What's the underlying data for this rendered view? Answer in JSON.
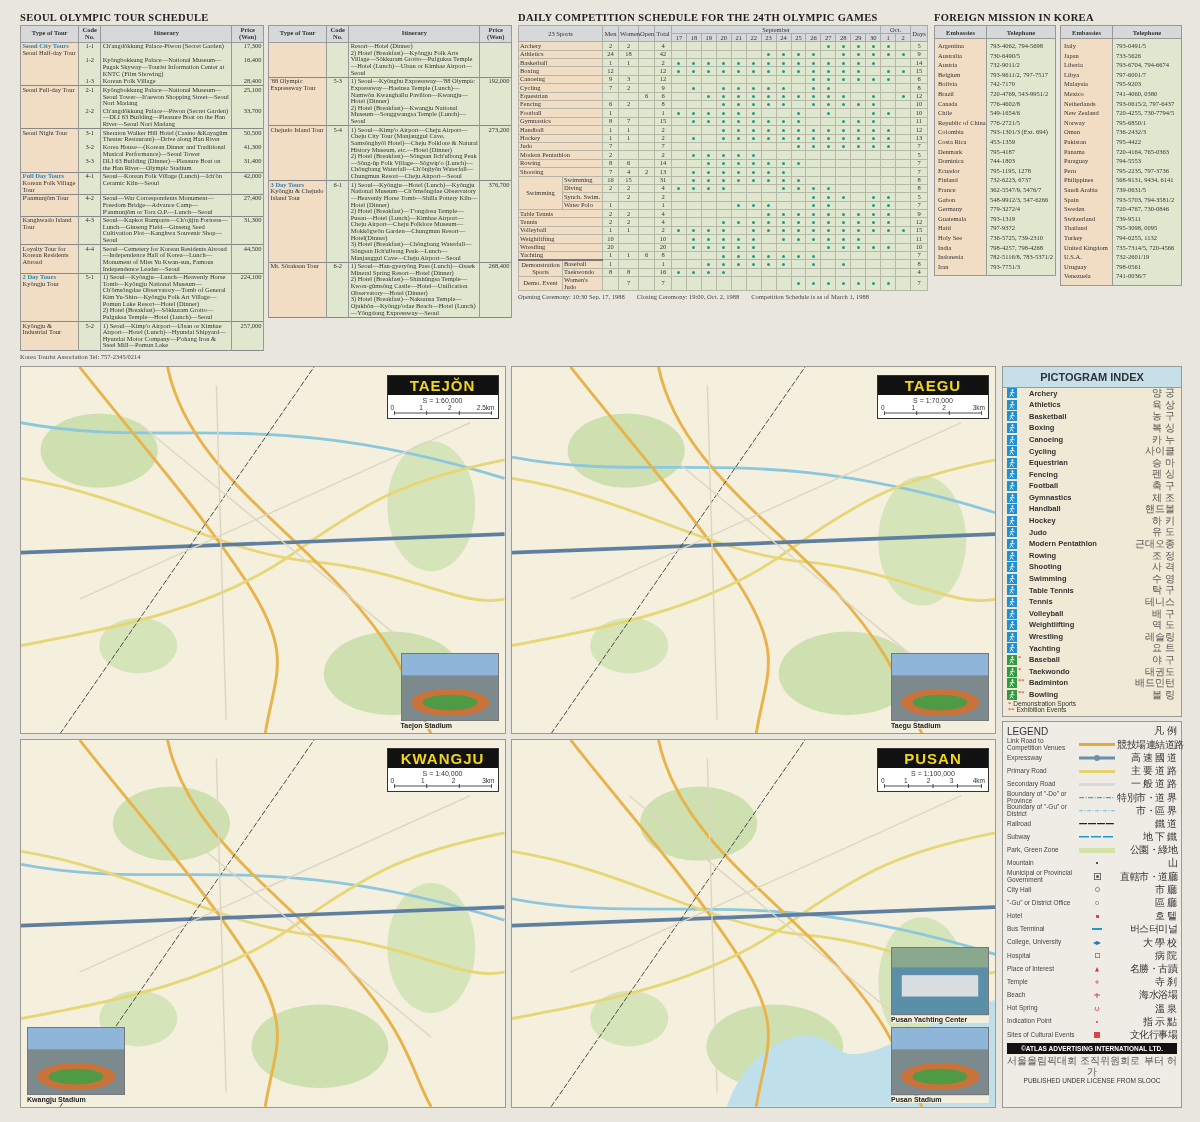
{
  "tour_schedule": {
    "title": "SEOUL OLYMPIC TOUR SCHEDULE",
    "tables": [
      {
        "columns": [
          "Type of Tour",
          "Code No.",
          "Itinerary",
          "Price (Won)"
        ],
        "rows": [
          {
            "group": "Seoul City Tours",
            "type": "Seoul Half-day Tour",
            "code": "1-1",
            "itinerary": [
              "Ch'angdŏkkung Palace-Piwon (Secret Garden)"
            ],
            "price": "17,300"
          },
          {
            "code": "1-2",
            "itinerary": [
              "Kyŏngbokkung Palace—National Museum—Pugak Skyway—Tourist Information Center at KNTC (Film Showing)"
            ],
            "price": "16,400"
          },
          {
            "code": "1-3",
            "itinerary": [
              "Korean Folk Village"
            ],
            "price": "28,400"
          },
          {
            "type": "Seoul Full-day Tour",
            "code": "2-1",
            "itinerary": [
              "Kyŏngbokkung Palace—National Museum—Seoul Tower—It'aewon Shopping Street—Seoul Nori Madang"
            ],
            "price": "25,100"
          },
          {
            "code": "2-2",
            "itinerary": [
              "Ch'angdŏkkung Palace—Piwon (Secret Garden)—DLI 63 Building—Pleasure Boat on the Han River—Seoul Nori Madang"
            ],
            "price": "33,700"
          },
          {
            "type": "Seoul Night Tour",
            "code": "3-1",
            "itinerary": [
              "Sheraton Walker Hill Hotel (Casino &Kayagŭm Theater Restaurant)—Drive along Han River"
            ],
            "price": "50,500"
          },
          {
            "code": "3-2",
            "itinerary": [
              "Korea House—(Korean Dinner and Traditional Musical Performance)—Seoul Tower"
            ],
            "price": "41,300"
          },
          {
            "code": "3-3",
            "itinerary": [
              "DLI 63 Building (Dinner)—Pleasure Boat on the Han River—Olympic Stadium"
            ],
            "price": "31,400"
          },
          {
            "group": "Full Day Tours",
            "type": "Korean Folk Village Tour",
            "code": "4-1",
            "itinerary": [
              "Seoul—Korean Folk Village (Lunch)—Ich'ŏn Ceramic Kiln—Seoul"
            ],
            "price": "42,000"
          },
          {
            "type": "P'anmunjŏm Tour",
            "code": "4-2",
            "itinerary": [
              "Seoul—War Correspondents Monument—Freedom Bridge—Advance Camp—P'anmunjŏm or Tora O.P.—Lunch—Seoul"
            ],
            "price": "27,400"
          },
          {
            "type": "Kanghwado Island Tour",
            "code": "4-3",
            "itinerary": [
              "Seoul—Kapkot Ramparts—Ch'ojijin Fortress—Lunch—Ginseng Field—Ginseng Seed Cultivation Plot—Kanghwa Souvenir Shop—Seoul"
            ],
            "price": "31,300"
          },
          {
            "type": "Loyalty Tour for Korean Residents Abroad",
            "code": "4-4",
            "itinerary": [
              "Seoul—Cemetery for Korean Residents Abroad—Independence Hall of Korea—Lunch—Monument of Miss Yu Kwan-sun, Famous Independence Leader—Seoul"
            ],
            "price": "44,500"
          },
          {
            "group": "2 Day Tours",
            "type": "Kyŏngju Tour",
            "code": "5-1",
            "itinerary": [
              "1) Seoul—Kyŏngju—Lunch—Heavenly Horse Tomb—Kyŏngju National Museum—Ch'ŏmsŏngdae Observatory—Tomb of General Kim Yu-Shin—Kyŏngju Folk Art Village—Pomun Lake Resort—Hotel (Dinner)",
              "2) Hotel (Breakfast)—Sŏkkuram Grotto—Pulguksa Temple—Hotel (Lunch)—Seoul"
            ],
            "price": "224,100"
          },
          {
            "type": "Kyŏngju & Industrial Tour",
            "code": "5-2",
            "itinerary": [
              "1) Seoul—Kimp'o Airport—Ulsan or Kimhae Airport—Hotel (Lunch)—Hyundai Shipyard—Hyundai Motor Company—P'ohang Iron & Steel Mill—Pomun Lake"
            ],
            "price": "257,000"
          }
        ]
      },
      {
        "columns": [
          "Type of Tour",
          "Code No.",
          "Itinerary",
          "Price (Won)"
        ],
        "rows": [
          {
            "itinerary": [
              "Resort—Hotel (Dinner)",
              "2) Hotel (Breakfast)—Kyŏngju Folk Arts Village—Sŏkkuram Grotto—Pulguksa Temple—Hotel (Lunch)—Ulsan or Kimhae Airport—Seoul"
            ]
          },
          {
            "type": "'88 Olympic Expressway Tour",
            "code": "5-3",
            "itinerary": [
              "1) Seoul—Kyŏngbu Expressway—'88 Olympic Expressway—Haeinsa Temple (Lunch)—Namwŏn Kwanghallu Pavilion—Kwangju—Hotel (Dinner)",
              "2) Hotel (Breakfast)—Kwangju National Museum—Songgwangsa Temple (Lunch)—Seoul"
            ],
            "price": "192,000"
          },
          {
            "type": "Chejudo Island Tour",
            "code": "5-4",
            "itinerary": [
              "1) Seoul—Kimp'o Airport—Cheju Airport—Cheju City Tour (Manjanggul Cave, Samsŏnghyŏl Hotel)—Cheju Folklore & Natural History Museum, etc.—Hotel (Dinner)",
              "2) Hotel (Breakfast)—Sŏngsan Ilch'ulbong Peak—Sŏng-ŭp Folk Village—Sŏgwip'o (Lunch)—Chŏngbang Waterfall—Ch'ŏnjiyŏn Waterfall—Chungmun Resort—Cheju Airport—Seoul"
            ],
            "price": "273,200"
          },
          {
            "group": "3 Day Tours",
            "type": "Kyŏngju & Chejudo Island Tour",
            "code": "6-1",
            "itinerary": [
              "1) Seoul—Kyŏngju—Hotel (Lunch)—Kyŏngju National Museum—Ch'ŏmsŏngdae Observatory—Heavenly Horse Tomb—Shilla Pottery Kiln—Hotel (Dinner)",
              "2) Hotel (Breakfast)—T'ongdosa Temple—Pusan—Hotel (Lunch)—Kimhae Airport—Cheju Airport—Cheju Folklore Museum—Mokkŏgwŏn Garden—Chungmun Resort—Hotel(Dinner)",
              "3) Hotel (Breakfast)—Chŏngbang Waterfall—Sŏngsan Ilch'ulbong Peak—Lunch—Manjanggul Cave—Cheju Airport—Seoul"
            ],
            "price": "376,700"
          },
          {
            "type": "Mt. Sŏraksan Tour",
            "code": "6-2",
            "itinerary": [
              "1) Seoul—Han-gyeryŏng Pass (Lunch)—Osaek Mineral Spring Resort—Hotel (Dinner)",
              "2) Hotel (Breakfast)—Shinhŭngsa Temple—Kwon-gŭmsŏng Castle—Hotel—Unification Observatory—Hotel (Dinner)",
              "3) Hotel (Breakfast)—Naksansa Temple—Ojukhŏn—Kyŏngp'odae Beach—Hotel (Lunch)—Yŏngdong Expressway—Seoul"
            ],
            "price": "268,400"
          }
        ]
      }
    ],
    "footer": "Korea Tourist Association   Tel: 757-2345/0214"
  },
  "competition_schedule": {
    "title": "DAILY COMPETITION SCHEDULE FOR THE 24TH OLYMPIC GAMES",
    "headers": {
      "sports": "23 Sports",
      "men": "Men",
      "women": "Women",
      "open": "Open",
      "total": "Total",
      "september": "September",
      "october": "Oct.",
      "days": "Days"
    },
    "september_days": [
      "17",
      "18",
      "19",
      "20",
      "21",
      "22",
      "23",
      "24",
      "25",
      "26",
      "27",
      "28",
      "29",
      "30"
    ],
    "october_days": [
      "1",
      "2"
    ],
    "rows": [
      {
        "sport": "Archery",
        "men": "2",
        "women": "2",
        "total": "4",
        "days": "5",
        "days_on": [
          false,
          false,
          false,
          false,
          false,
          false,
          false,
          false,
          false,
          false,
          true,
          true,
          true,
          true,
          true,
          false
        ]
      },
      {
        "sport": "Athletics",
        "men": "24",
        "women": "18",
        "total": "42",
        "days": "9",
        "days_on": [
          false,
          false,
          false,
          false,
          false,
          false,
          true,
          true,
          true,
          true,
          false,
          true,
          true,
          true,
          true,
          true
        ]
      },
      {
        "sport": "Basketball",
        "men": "1",
        "women": "1",
        "total": "2",
        "days": "14",
        "days_on": [
          true,
          true,
          true,
          true,
          true,
          true,
          true,
          true,
          true,
          true,
          true,
          true,
          true,
          true,
          false,
          false
        ]
      },
      {
        "sport": "Boxing",
        "men": "12",
        "total": "12",
        "days": "15",
        "days_on": [
          true,
          true,
          true,
          true,
          true,
          true,
          true,
          true,
          true,
          true,
          true,
          true,
          true,
          false,
          true,
          true
        ]
      },
      {
        "sport": "Canoeing",
        "men": "9",
        "women": "3",
        "total": "12",
        "days": "6",
        "days_on": [
          false,
          false,
          false,
          false,
          false,
          false,
          false,
          false,
          false,
          true,
          true,
          true,
          true,
          true,
          true,
          false
        ]
      },
      {
        "sport": "Cycling",
        "men": "7",
        "women": "2",
        "total": "9",
        "days": "8",
        "days_on": [
          false,
          true,
          false,
          true,
          true,
          true,
          true,
          true,
          false,
          true,
          true,
          false,
          false,
          false,
          false,
          false
        ]
      },
      {
        "sport": "Equestrian",
        "open": "6",
        "total": "6",
        "days": "12",
        "days_on": [
          false,
          false,
          true,
          true,
          true,
          true,
          true,
          true,
          true,
          true,
          true,
          true,
          false,
          true,
          false,
          true
        ]
      },
      {
        "sport": "Fencing",
        "men": "6",
        "women": "2",
        "total": "8",
        "days": "10",
        "days_on": [
          false,
          false,
          false,
          true,
          true,
          true,
          true,
          true,
          false,
          true,
          true,
          true,
          true,
          true,
          false,
          false
        ]
      },
      {
        "sport": "Football",
        "men": "1",
        "total": "1",
        "days": "10",
        "days_on": [
          true,
          true,
          true,
          true,
          true,
          true,
          false,
          false,
          true,
          false,
          true,
          false,
          false,
          true,
          true,
          false
        ]
      },
      {
        "sport": "Gymnastics",
        "men": "8",
        "women": "7",
        "total": "15",
        "days": "11",
        "days_on": [
          false,
          true,
          true,
          true,
          true,
          true,
          true,
          true,
          true,
          false,
          false,
          true,
          true,
          true,
          false,
          false
        ]
      },
      {
        "sport": "Handball",
        "men": "1",
        "women": "1",
        "total": "2",
        "days": "12",
        "days_on": [
          false,
          false,
          false,
          true,
          true,
          true,
          true,
          true,
          true,
          true,
          true,
          true,
          true,
          true,
          true,
          false
        ]
      },
      {
        "sport": "Hockey",
        "men": "1",
        "women": "1",
        "total": "2",
        "days": "13",
        "days_on": [
          false,
          true,
          false,
          true,
          true,
          true,
          true,
          true,
          true,
          true,
          true,
          true,
          true,
          true,
          true,
          false
        ]
      },
      {
        "sport": "Judo",
        "men": "7",
        "total": "7",
        "days": "7",
        "days_on": [
          false,
          false,
          false,
          false,
          false,
          false,
          false,
          false,
          true,
          true,
          true,
          true,
          true,
          true,
          true,
          false
        ]
      },
      {
        "sport": "Modern Pentathlon",
        "men": "2",
        "total": "2",
        "days": "5",
        "days_on": [
          false,
          true,
          true,
          true,
          true,
          true,
          false,
          false,
          false,
          false,
          false,
          false,
          false,
          false,
          false,
          false
        ]
      },
      {
        "sport": "Rowing",
        "men": "8",
        "women": "6",
        "total": "14",
        "days": "7",
        "days_on": [
          false,
          false,
          true,
          true,
          true,
          true,
          true,
          true,
          true,
          false,
          false,
          false,
          false,
          false,
          false,
          false
        ]
      },
      {
        "sport": "Shooting",
        "men": "7",
        "women": "4",
        "open": "2",
        "total": "13",
        "days": "7",
        "days_on": [
          false,
          true,
          true,
          true,
          true,
          true,
          true,
          true,
          false,
          false,
          false,
          false,
          false,
          false,
          false,
          false
        ]
      },
      {
        "sport": "Swimming",
        "events": [
          {
            "event": "Swimming",
            "men": "16",
            "women": "15",
            "total": "31",
            "days": "8",
            "days_on": [
              false,
              true,
              true,
              true,
              true,
              true,
              true,
              true,
              true,
              false,
              false,
              false,
              false,
              false,
              false,
              false
            ]
          },
          {
            "event": "Diving",
            "men": "2",
            "women": "2",
            "total": "4",
            "days": "8",
            "days_on": [
              true,
              true,
              true,
              true,
              false,
              false,
              false,
              true,
              true,
              true,
              true,
              false,
              false,
              false,
              false,
              false
            ]
          },
          {
            "event": "Synch. Swim.",
            "women": "2",
            "total": "2",
            "days": "5",
            "days_on": [
              false,
              false,
              false,
              false,
              false,
              false,
              false,
              false,
              false,
              true,
              true,
              true,
              false,
              true,
              true,
              false
            ]
          },
          {
            "event": "Water Polo",
            "men": "1",
            "total": "1",
            "days": "7",
            "days_on": [
              false,
              false,
              false,
              false,
              true,
              true,
              true,
              false,
              false,
              true,
              true,
              false,
              false,
              true,
              true,
              false
            ]
          }
        ]
      },
      {
        "sport": "Table Tennis",
        "men": "2",
        "women": "2",
        "total": "4",
        "days": "9",
        "days_on": [
          false,
          false,
          false,
          false,
          false,
          false,
          true,
          true,
          true,
          true,
          true,
          true,
          true,
          true,
          true,
          false
        ]
      },
      {
        "sport": "Tennis",
        "men": "2",
        "women": "2",
        "total": "4",
        "days": "12",
        "days_on": [
          false,
          false,
          false,
          true,
          true,
          true,
          true,
          true,
          true,
          true,
          true,
          true,
          true,
          true,
          true,
          false
        ]
      },
      {
        "sport": "Volleyball",
        "men": "1",
        "women": "1",
        "total": "2",
        "days": "15",
        "days_on": [
          true,
          true,
          true,
          true,
          false,
          true,
          true,
          true,
          true,
          true,
          true,
          true,
          true,
          true,
          true,
          true
        ]
      },
      {
        "sport": "Weightlifting",
        "men": "10",
        "total": "10",
        "days": "11",
        "days_on": [
          false,
          true,
          true,
          true,
          true,
          true,
          false,
          true,
          true,
          true,
          true,
          true,
          true,
          false,
          false,
          false
        ]
      },
      {
        "sport": "Wrestling",
        "men": "20",
        "total": "20",
        "days": "10",
        "days_on": [
          false,
          true,
          true,
          true,
          true,
          true,
          false,
          false,
          false,
          false,
          true,
          true,
          true,
          true,
          true,
          false
        ]
      },
      {
        "sport": "Yachting",
        "men": "1",
        "women": "1",
        "open": "6",
        "total": "8",
        "days": "7",
        "days_on": [
          false,
          false,
          false,
          true,
          true,
          true,
          true,
          true,
          true,
          true,
          false,
          false,
          false,
          false,
          false,
          false
        ]
      },
      {
        "sport": "Demonstration Sports",
        "separated": true,
        "events": [
          {
            "event": "Baseball",
            "men": "1",
            "total": "1",
            "days": "8",
            "days_on": [
              false,
              false,
              true,
              true,
              true,
              true,
              true,
              true,
              false,
              true,
              false,
              true,
              false,
              false,
              false,
              false
            ]
          },
          {
            "event": "Taekwondo",
            "men": "8",
            "women": "8",
            "total": "16",
            "days": "4",
            "days_on": [
              true,
              true,
              true,
              true,
              false,
              false,
              false,
              false,
              false,
              false,
              false,
              false,
              false,
              false,
              false,
              false
            ]
          }
        ]
      },
      {
        "sport": "Demo. Event",
        "events": [
          {
            "event": "Women's Judo",
            "women": "7",
            "total": "7",
            "days": "7",
            "days_on": [
              false,
              false,
              false,
              false,
              false,
              false,
              false,
              false,
              true,
              true,
              true,
              true,
              true,
              true,
              true,
              false
            ]
          }
        ]
      }
    ],
    "notes": [
      "Opening Ceremony: 10:30 Sep. 17, 1988",
      "Closing Ceremony: 19:00, Oct. 2, 1988",
      "Competition Schedule is as of March 1, 1988"
    ]
  },
  "foreign_missions": {
    "title": "FOREIGN MISSION IN KOREA",
    "tables": [
      {
        "columns": [
          "Embassies",
          "Telephone"
        ],
        "rows": [
          {
            "country": "Argentina",
            "phone": "793-4062, 794-5698"
          },
          {
            "country": "Australia",
            "phone": "730-6490/5"
          },
          {
            "country": "Austria",
            "phone": "732-9011/2"
          },
          {
            "country": "Belgium",
            "phone": "793-9611/2, 797-7517"
          },
          {
            "country": "Bolivia",
            "phone": "742-7170"
          },
          {
            "country": "Brazil",
            "phone": "720-4769, 543-9951/2"
          },
          {
            "country": "Canada",
            "phone": "776-4602/8"
          },
          {
            "country": "Chile",
            "phone": "549-1654/6"
          },
          {
            "country": "Republic of China",
            "phone": "776-2721/5"
          },
          {
            "country": "Colombia",
            "phone": "793-1301/3 (Ext. 694)"
          },
          {
            "country": "Costa Rica",
            "phone": "453-1359"
          },
          {
            "country": "Denmark",
            "phone": "795-4187"
          },
          {
            "country": "Dominica",
            "phone": "744-1803"
          },
          {
            "country": "Ecuador",
            "phone": "795-1195, 1278"
          },
          {
            "country": "Finland",
            "phone": "732-6223, 6737"
          },
          {
            "country": "France",
            "phone": "362-5547/9, 5476/7"
          },
          {
            "country": "Gabon",
            "phone": "548-9912/3, 547-6266"
          },
          {
            "country": "Germany",
            "phone": "779-3272/4"
          },
          {
            "country": "Guatemala",
            "phone": "793-1319"
          },
          {
            "country": "Haiti",
            "phone": "797-9372"
          },
          {
            "country": "Holy See",
            "phone": "736-5725, 739-2310"
          },
          {
            "country": "India",
            "phone": "798-4257, 798-4268"
          },
          {
            "country": "Indonesia",
            "phone": "782-5116/8, 783-5371/2"
          },
          {
            "country": "Iran",
            "phone": "793-7751/3"
          }
        ]
      },
      {
        "columns": [
          "Embassies",
          "Telephone"
        ],
        "rows": [
          {
            "country": "Italy",
            "phone": "793-0491/5"
          },
          {
            "country": "Japan",
            "phone": "733-5626"
          },
          {
            "country": "Liberia",
            "phone": "793-6704, 794-6674"
          },
          {
            "country": "Libya",
            "phone": "797-6001/7"
          },
          {
            "country": "Malaysia",
            "phone": "795-9203"
          },
          {
            "country": "Mexico",
            "phone": "741-4060, 0380"
          },
          {
            "country": "Netherlands",
            "phone": "793-0615/2, 797-6437"
          },
          {
            "country": "New Zealand",
            "phone": "720-4255, 730-7794/5"
          },
          {
            "country": "Norway",
            "phone": "795-6850/1"
          },
          {
            "country": "Oman",
            "phone": "736-2432/3"
          },
          {
            "country": "Pakistan",
            "phone": "795-4422"
          },
          {
            "country": "Panama",
            "phone": "720-4164, 765-0363"
          },
          {
            "country": "Paraguay",
            "phone": "794-5553"
          },
          {
            "country": "Peru",
            "phone": "795-2235, 797-3736"
          },
          {
            "country": "Philippines",
            "phone": "568-9131, 9434, 6141"
          },
          {
            "country": "Saudi Arabia",
            "phone": "739-0631/5"
          },
          {
            "country": "Spain",
            "phone": "793-5703, 794-3581/2"
          },
          {
            "country": "Sweden",
            "phone": "720-4767, 730-0846"
          },
          {
            "country": "Switzerland",
            "phone": "739-9511"
          },
          {
            "country": "Thailand",
            "phone": "795-3098, 0095"
          },
          {
            "country": "Turkey",
            "phone": "794-0255, 1132"
          },
          {
            "country": "United Kingdom",
            "phone": "735-7314/5, 720-4566"
          },
          {
            "country": "U.S.A.",
            "phone": "732-2601/19"
          },
          {
            "country": "Uruguay",
            "phone": "798-0561"
          },
          {
            "country": "Venezuela",
            "phone": "741-0036/7"
          }
        ]
      }
    ]
  },
  "maps": [
    {
      "title": "TAEJŎN",
      "scale": "S = 1:60,000",
      "ticks": [
        "0",
        "1",
        "2",
        "2.5km"
      ],
      "kind": "inland",
      "photos": [
        {
          "caption": "Taejon Stadium",
          "kind": "stadium"
        }
      ]
    },
    {
      "title": "TAEGU",
      "scale": "S = 1:70,000",
      "ticks": [
        "0",
        "1",
        "2",
        "3km"
      ],
      "kind": "inland",
      "photos": [
        {
          "caption": "Taegu Stadium",
          "kind": "stadium"
        }
      ]
    },
    {
      "title": "KWANGJU",
      "scale": "S = 1:40,000",
      "ticks": [
        "0",
        "1",
        "2",
        "3km"
      ],
      "kind": "inland",
      "photos": [
        {
          "caption": "Kwangju Stadium",
          "kind": "stadium"
        }
      ]
    },
    {
      "title": "PUSAN",
      "scale": "S = 1:100,000",
      "ticks": [
        "0",
        "1",
        "2",
        "3",
        "4km"
      ],
      "kind": "coastal",
      "photos": [
        {
          "caption": "Pusan Yachting Center",
          "kind": "harbor"
        },
        {
          "caption": "Pusan Stadium",
          "kind": "stadium"
        }
      ]
    }
  ],
  "pictogram_index": {
    "title": "PICTOGRAM INDEX",
    "items": [
      {
        "name": "Archery",
        "korean": "양 궁",
        "kind": "olympic"
      },
      {
        "name": "Athletics",
        "korean": "육 상",
        "kind": "olympic"
      },
      {
        "name": "Basketball",
        "korean": "농 구",
        "kind": "olympic"
      },
      {
        "name": "Boxing",
        "korean": "복 싱",
        "kind": "olympic"
      },
      {
        "name": "Canoeing",
        "korean": "카 누",
        "kind": "olympic"
      },
      {
        "name": "Cycling",
        "korean": "사이클",
        "kind": "olympic"
      },
      {
        "name": "Equestrian",
        "korean": "승 마",
        "kind": "olympic"
      },
      {
        "name": "Fencing",
        "korean": "펜 싱",
        "kind": "olympic"
      },
      {
        "name": "Football",
        "korean": "축 구",
        "kind": "olympic"
      },
      {
        "name": "Gymnastics",
        "korean": "체 조",
        "kind": "olympic"
      },
      {
        "name": "Handball",
        "korean": "핸드볼",
        "kind": "olympic"
      },
      {
        "name": "Hockey",
        "korean": "하 키",
        "kind": "olympic"
      },
      {
        "name": "Judo",
        "korean": "유 도",
        "kind": "olympic"
      },
      {
        "name": "Modern Pentathlon",
        "korean": "근대오종",
        "kind": "olympic"
      },
      {
        "name": "Rowing",
        "korean": "조 정",
        "kind": "olympic"
      },
      {
        "name": "Shooting",
        "korean": "사 격",
        "kind": "olympic"
      },
      {
        "name": "Swimming",
        "korean": "수 영",
        "kind": "olympic"
      },
      {
        "name": "Table Tennis",
        "korean": "탁 구",
        "kind": "olympic"
      },
      {
        "name": "Tennis",
        "korean": "테니스",
        "kind": "olympic"
      },
      {
        "name": "Volleyball",
        "korean": "배 구",
        "kind": "olympic"
      },
      {
        "name": "Weightlifting",
        "korean": "역 도",
        "kind": "olympic"
      },
      {
        "name": "Wrestling",
        "korean": "레슬링",
        "kind": "olympic"
      },
      {
        "name": "Yachting",
        "korean": "요 트",
        "kind": "olympic"
      },
      {
        "name": "Baseball",
        "korean": "야 구",
        "kind": "demonstration",
        "mark": "*"
      },
      {
        "name": "Taekwondo",
        "korean": "태권도",
        "kind": "demonstration",
        "mark": "*"
      },
      {
        "name": "Badminton",
        "korean": "배드민턴",
        "kind": "exhibition",
        "mark": "**"
      },
      {
        "name": "Bowling",
        "korean": "볼 링",
        "kind": "exhibition",
        "mark": "**"
      }
    ],
    "notes": [
      {
        "mark": "*",
        "text": "Demonstration Sports"
      },
      {
        "mark": "**",
        "text": "Exhibition Events"
      }
    ]
  },
  "legend": {
    "title": "LEGEND",
    "title_korean": "凡 例",
    "items": [
      {
        "label": "Link Road to Competition Venues",
        "korean": "競技場連結道路",
        "kind": "link"
      },
      {
        "label": "Expressway",
        "korean": "高 速 國 道",
        "kind": "expressway"
      },
      {
        "label": "Primary Road",
        "korean": "主 要 道 路",
        "kind": "primary"
      },
      {
        "label": "Secondary Road",
        "korean": "一 般 道 路",
        "kind": "secondary"
      },
      {
        "label": "Boundary of \"-Do\" or Province",
        "korean": "特別市・道 界",
        "kind": "province"
      },
      {
        "label": "Boundary of \"-Gu\" or District",
        "korean": "市・區 界",
        "kind": "district"
      },
      {
        "label": "Railroad",
        "korean": "鐵 道",
        "kind": "railroad"
      },
      {
        "label": "Subway",
        "korean": "地 下 鐵",
        "kind": "subway"
      },
      {
        "label": "Park, Green Zone",
        "korean": "公園・綠地",
        "kind": "park"
      },
      {
        "label": "Mountain",
        "korean": "山",
        "kind": "mountain"
      },
      {
        "label": "Municipal or Provincial Government",
        "korean": "直轄市・道廳",
        "kind": "government"
      },
      {
        "label": "City Hall",
        "korean": "市 廳",
        "kind": "cityhall"
      },
      {
        "label": "\"-Gu\" or District Office",
        "korean": "區 廳",
        "kind": "office"
      },
      {
        "label": "Hotel",
        "korean": "호 텔",
        "kind": "hotel"
      },
      {
        "label": "Bus Terminal",
        "korean": "버스터미널",
        "kind": "bus"
      },
      {
        "label": "College, University",
        "korean": "大 學 校",
        "kind": "college"
      },
      {
        "label": "Hospital",
        "korean": "病 院",
        "kind": "hospital"
      },
      {
        "label": "Place of Interest",
        "korean": "名勝・古蹟",
        "kind": "interest"
      },
      {
        "label": "Temple",
        "korean": "寺 刹",
        "kind": "temple"
      },
      {
        "label": "Beach",
        "korean": "海水浴場",
        "kind": "beach"
      },
      {
        "label": "Hot Spring",
        "korean": "溫 泉",
        "kind": "spring"
      },
      {
        "label": "Indication Point",
        "korean": "指 示 點",
        "kind": "point"
      },
      {
        "label": "Sites of Cultural Events",
        "korean": "文化行事場",
        "kind": "culture"
      }
    ],
    "copyright": "©ATLAS ADVERTISING  INTERNATIONAL LTD.",
    "license_korean": "서울올림픽대회 조직위원회로 부터 허가",
    "license": "PUBLISHED UNDER LICENSE FROM SLOOC"
  }
}
